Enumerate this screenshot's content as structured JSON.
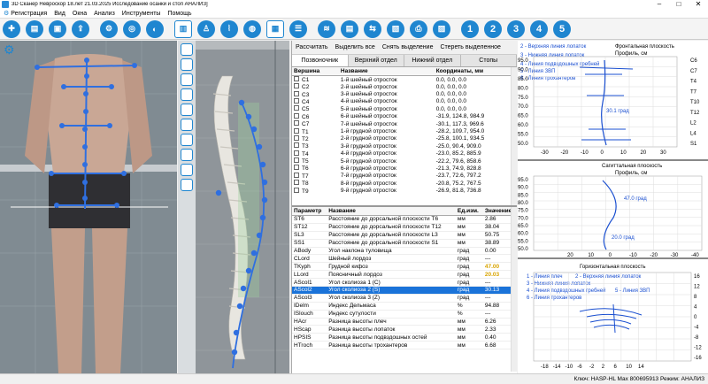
{
  "title": "3D Сканер Невроскор                18.лет 21.03.2025 Исследование осанки и стоп АНАЛИЗ]",
  "menu": [
    "Регистрация",
    "Вид",
    "Окна",
    "Анализ",
    "Инструменты",
    "Помощь"
  ],
  "toolbar_numbers": [
    "1",
    "2",
    "3",
    "4",
    "5"
  ],
  "actions": [
    "Рассчитать",
    "Выделить все",
    "Снять выделение",
    "Стереть выделенное"
  ],
  "tabs": [
    "Позвоночник",
    "Верхний отдел",
    "Нижний отдел",
    "Стопы"
  ],
  "vertebra_table": {
    "headers": [
      "Вершина",
      "Название",
      "Координаты, мм"
    ],
    "rows": [
      [
        "C1",
        "1-й шейный отросток",
        "0.0, 0.0, 0.0"
      ],
      [
        "C2",
        "2-й шейный отросток",
        "0.0, 0.0, 0.0"
      ],
      [
        "C3",
        "3-й шейный отросток",
        "0.0, 0.0, 0.0"
      ],
      [
        "C4",
        "4-й шейный отросток",
        "0.0, 0.0, 0.0"
      ],
      [
        "C5",
        "5-й шейный отросток",
        "0.0, 0.0, 0.0"
      ],
      [
        "C6",
        "6-й шейный отросток",
        "-31.9, 124.8, 984.9"
      ],
      [
        "C7",
        "7-й шейный отросток",
        "-30.1, 117.3, 969.6"
      ],
      [
        "T1",
        "1-й грудной отросток",
        "-28.2, 109.7, 954.0"
      ],
      [
        "T2",
        "2-й грудной отросток",
        "-25.8, 100.1, 934.5"
      ],
      [
        "T3",
        "3-й грудной отросток",
        "-25.0, 90.4, 909.0"
      ],
      [
        "T4",
        "4-й грудной отросток",
        "-23.0, 85.2, 885.9"
      ],
      [
        "T5",
        "5-й грудной отросток",
        "-22.2, 79.6, 858.6"
      ],
      [
        "T6",
        "6-й грудной отросток",
        "-21.3, 74.9, 828.8"
      ],
      [
        "T7",
        "7-й грудной отросток",
        "-23.7, 72.6, 797.2"
      ],
      [
        "T8",
        "8-й грудной отросток",
        "-20.8, 75.2, 767.5"
      ],
      [
        "T9",
        "9-й грудной отросток",
        "-26.9, 81.8, 736.8"
      ]
    ]
  },
  "param_table": {
    "headers": [
      "Параметр",
      "Название",
      "Ед.изм.",
      "Значение"
    ],
    "rows": [
      [
        "ST6",
        "Расстояние до дорсальной плоскости T6",
        "мм",
        "2.86"
      ],
      [
        "ST12",
        "Расстояние до дорсальной плоскости T12",
        "мм",
        "38.04"
      ],
      [
        "SL3",
        "Расстояние до дорсальной плоскости L3",
        "мм",
        "50.75"
      ],
      [
        "SS1",
        "Расстояние до дорсальной плоскости S1",
        "мм",
        "38.89"
      ],
      [
        "ABody",
        "Угол наклона туловища",
        "град",
        "0.00"
      ],
      [
        "CLord",
        "Шейный лордоз",
        "град",
        "---"
      ],
      [
        "TKyph",
        "Грудной кифоз",
        "град",
        "47.00"
      ],
      [
        "LLord",
        "Поясничный лордоз",
        "град",
        "20.03"
      ],
      [
        "AScol1",
        "Угол сколиоза 1 (С)",
        "град",
        "---"
      ],
      [
        "AScol2",
        "Угол сколиоза 2 (S)",
        "град",
        "30.13"
      ],
      [
        "AScol3",
        "Угол сколиоза 3 (Z)",
        "град",
        "---"
      ],
      [
        "IDelm",
        "Индекс Дельмаса",
        "%",
        "94.88"
      ],
      [
        "ISlouch",
        "Индекс сутулости",
        "%",
        "---"
      ],
      [
        "HAcr",
        "Разница высоты плеч",
        "мм",
        "6.26"
      ],
      [
        "HScap",
        "Разница высоты лопаток",
        "мм",
        "2.33"
      ],
      [
        "HPSIS",
        "Разница высоты подвздошных остей",
        "мм",
        "0.40"
      ],
      [
        "HTroch",
        "Разница высоты трохантеров",
        "мм",
        "6.68"
      ]
    ]
  },
  "chart1": {
    "title": "Фронтальная плоскость",
    "subtitle": "Профиль, см",
    "legend": [
      "2 - Верхняя линия лопаток",
      "3 - Нижняя линия лопаток",
      "4 - Линия подвздошных гребней",
      "5 - Линия ЗВП",
      "6 - Линия трохантеров"
    ],
    "yticks": [
      "95.0",
      "90.0",
      "85.0",
      "80.0",
      "75.0",
      "70.0",
      "65.0",
      "60.0",
      "55.0",
      "50.0"
    ],
    "xticks": [
      "-30",
      "-20",
      "-10",
      "0",
      "10",
      "20",
      "30"
    ],
    "right_labels": [
      "C6",
      "C7",
      "T4",
      "T7",
      "T10",
      "T12",
      "L2",
      "L4",
      "S1"
    ],
    "annotation": "30.1 град"
  },
  "chart2": {
    "title": "Сагиттальная плоскость",
    "subtitle": "Профиль, см",
    "yticks": [
      "95.0",
      "90.0",
      "85.0",
      "80.0",
      "75.0",
      "70.0",
      "65.0",
      "60.0",
      "55.0",
      "50.0"
    ],
    "xticks": [
      "20",
      "10",
      "0",
      "-10",
      "-20",
      "-30",
      "-40"
    ],
    "annotations": [
      "47.0 град",
      "20.0 град"
    ]
  },
  "chart3": {
    "title": "Горизонтальная плоскость",
    "legend": [
      "1 - Линия плеч",
      "2 - Верхняя линия лопаток",
      "3 - Нижняя линия лопаток",
      "4 - Линия подвздошных гребней",
      "5 - Линия ЗВП",
      "6 - Линия трохантеров"
    ],
    "xticks": [
      "-18",
      "-14",
      "-10",
      "-6",
      "-2",
      "2",
      "6",
      "10",
      "14"
    ],
    "yticks": [
      "16",
      "12",
      "8",
      "4",
      "0",
      "-4",
      "-8",
      "-12",
      "-16"
    ]
  },
  "status": "Ключ: HASP-HL Max 800695913 Режим: АНАЛИЗ",
  "colors": {
    "accent": "#1f86d0",
    "selected": "#1a73d9",
    "highlight": "#d8a400",
    "chart_line": "#1a4fd0"
  }
}
